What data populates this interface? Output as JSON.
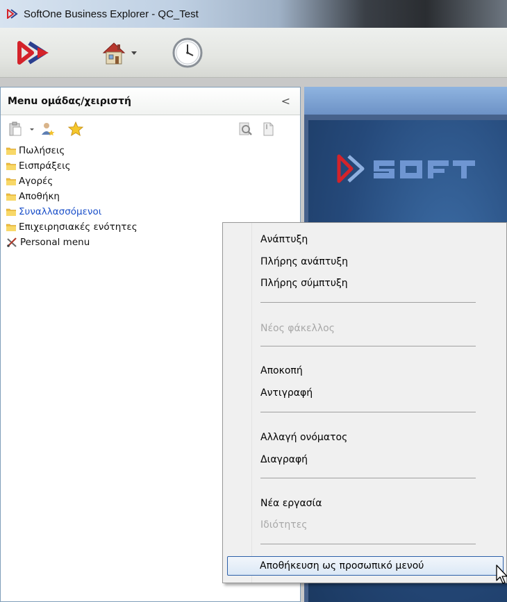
{
  "window": {
    "title": "SoftOne Business Explorer - QC_Test"
  },
  "toolbar": {
    "items": [
      "softone-logo-icon",
      "home-icon",
      "clock-icon"
    ]
  },
  "left_panel": {
    "title": "Menu ομάδας/χειριστή",
    "collapse_glyph": "<",
    "tree": [
      {
        "label": "Πωλήσεις",
        "icon": "folder-icon"
      },
      {
        "label": "Εισπράξεις",
        "icon": "folder-icon"
      },
      {
        "label": "Αγορές",
        "icon": "folder-icon"
      },
      {
        "label": "Αποθήκη",
        "icon": "folder-icon"
      },
      {
        "label": "Συναλλασσόμενοι",
        "icon": "folder-icon",
        "selected": true
      },
      {
        "label": "Επιχειρησιακές ενότητες",
        "icon": "folder-icon"
      },
      {
        "label": "Personal menu",
        "icon": "tools-icon"
      }
    ]
  },
  "context_menu": {
    "items": [
      {
        "label": "Ανάπτυξη",
        "enabled": true
      },
      {
        "label": "Πλήρης ανάπτυξη",
        "enabled": true
      },
      {
        "label": "Πλήρης σύμπτυξη",
        "enabled": true
      },
      {
        "label": "Νέος φάκελλος",
        "enabled": false
      },
      {
        "label": "Αποκοπή",
        "enabled": true
      },
      {
        "label": "Αντιγραφή",
        "enabled": true
      },
      {
        "label": "Αλλαγή ονόματος",
        "enabled": true
      },
      {
        "label": "Διαγραφή",
        "enabled": true
      },
      {
        "label": "Νέα εργασία",
        "enabled": true
      },
      {
        "label": "Ιδιότητες",
        "enabled": false
      },
      {
        "label": "Αποθήκευση ως προσωπικό μενού",
        "enabled": true,
        "highlighted": true
      }
    ]
  },
  "colors": {
    "selected_text": "#1a4fc9",
    "disabled_text": "#a8a8a8",
    "brand_red": "#d4232a",
    "brand_blue": "#2a3f8f"
  }
}
